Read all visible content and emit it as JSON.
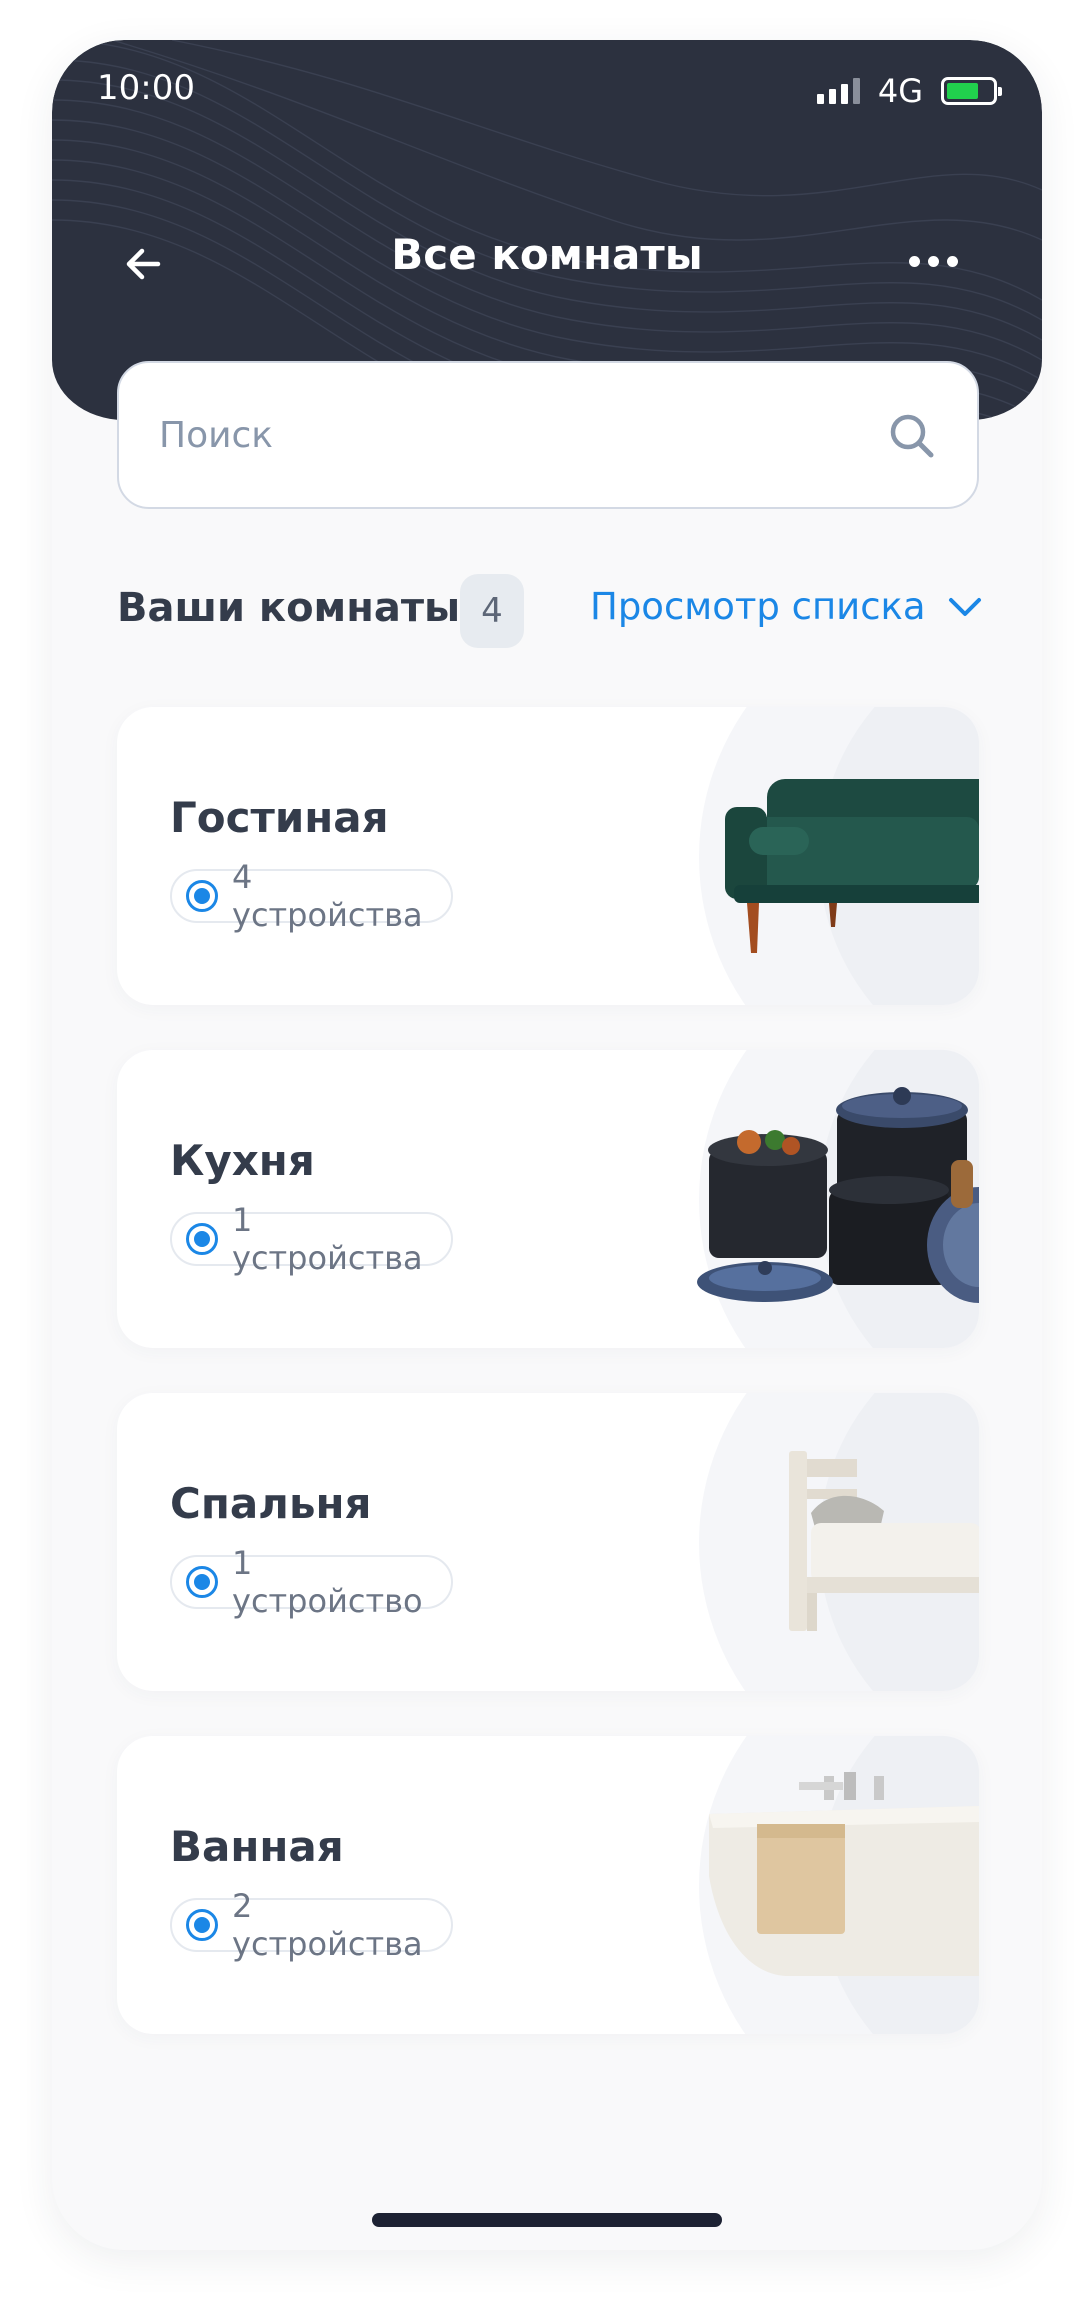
{
  "status_bar": {
    "time": "10:00",
    "network": "4G",
    "battery_color": "#21d04d"
  },
  "header": {
    "title": "Все комнаты",
    "back_icon": "arrow-left-icon",
    "menu_icon": "more-horizontal-icon",
    "background_color": "#2c313f"
  },
  "search": {
    "placeholder": "Поиск",
    "value": "",
    "icon": "search-icon"
  },
  "rooms_section": {
    "title": "Ваши комнаты",
    "count": "4",
    "view_toggle": "Просмотр списка",
    "toggle_icon": "chevron-down-icon",
    "accent_color": "#1b87e6"
  },
  "rooms": [
    {
      "name": "Гостиная",
      "devices": "4 устройства",
      "image": "sofa-image"
    },
    {
      "name": "Кухня",
      "devices": "1 устройства",
      "image": "cookware-image"
    },
    {
      "name": "Спальня",
      "devices": "1 устройство",
      "image": "bed-image"
    },
    {
      "name": "Ванная",
      "devices": "2 устройства",
      "image": "bathtub-image"
    }
  ]
}
